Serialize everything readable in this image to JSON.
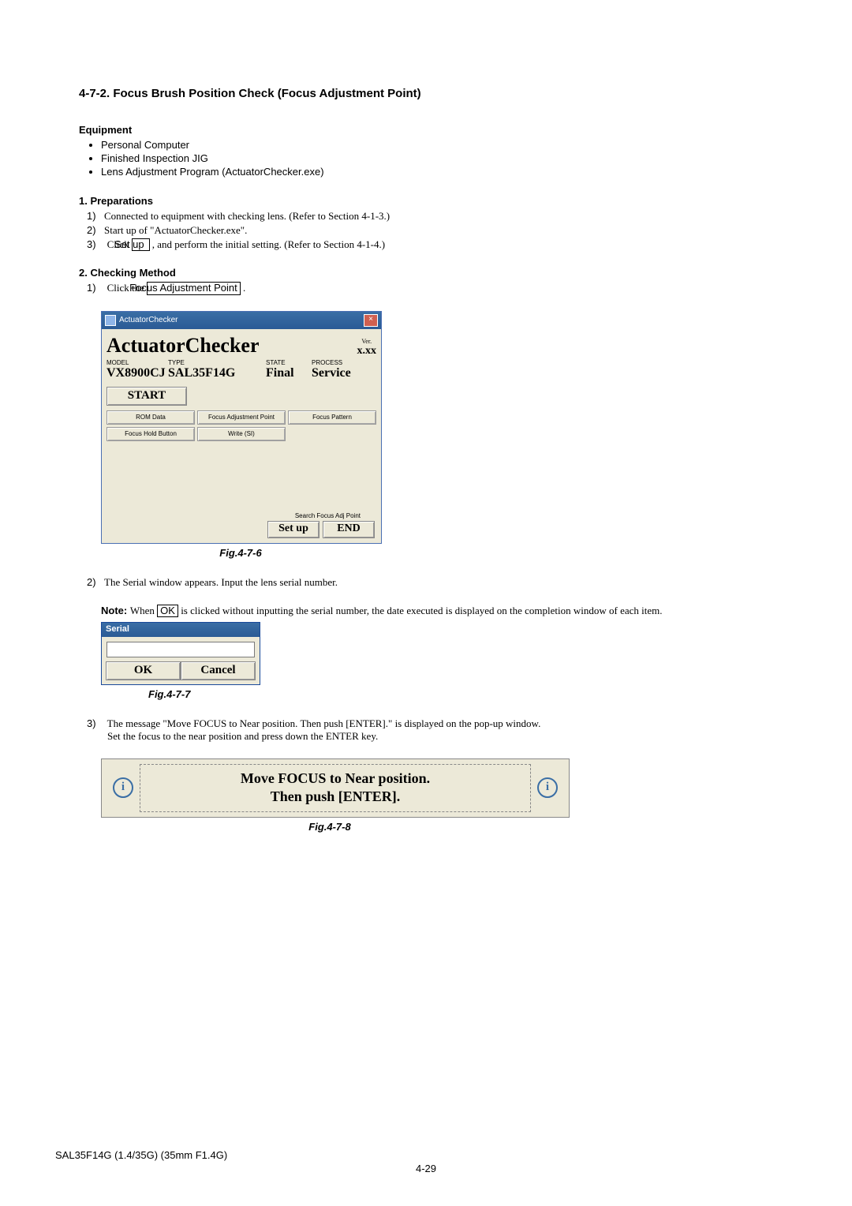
{
  "section": {
    "number": "4-7-2.",
    "title": "Focus Brush Position Check (Focus Adjustment Point)"
  },
  "equipment": {
    "heading": "Equipment",
    "items": [
      "Personal Computer",
      "Finished Inspection JIG",
      "Lens Adjustment Program (ActuatorChecker.exe)"
    ]
  },
  "preparations": {
    "heading": "1.  Preparations",
    "items": {
      "p1": "Connected to equipment with checking lens. (Refer to Section 4-1-3.)",
      "p2": "Start up of \"ActuatorChecker.exe\".",
      "p3_a": "Click ",
      "p3_box": "Set up",
      "p3_b": " , and perform the initial setting. (Refer to Section 4-1-4.)"
    }
  },
  "checking": {
    "heading": "2.  Checking Method",
    "step1_a": "Click the ",
    "step1_box": "Focus Adjustment Point",
    "step1_b": " ."
  },
  "ac_window": {
    "title": "ActuatorChecker",
    "app_title": "ActuatorChecker",
    "ver_label": "Ver.",
    "ver_value": "x.xx",
    "labels": {
      "model": "MODEL",
      "type": "TYPE",
      "state": "STATE",
      "process": "PROCESS"
    },
    "values": {
      "model": "VX8900CJ",
      "type": "SAL35F14G",
      "state": "Final",
      "process": "Service"
    },
    "start": "START",
    "grid": {
      "rom": "ROM Data",
      "fap": "Focus Adjustment Point",
      "fp": "Focus Pattern",
      "fhb": "Focus Hold Button",
      "wsi": "Write (SI)"
    },
    "search": "Search Focus Adj Point",
    "setup": "Set up",
    "end": "END"
  },
  "fig476": "Fig.4-7-6",
  "step2": "The Serial window appears. Input the lens serial number.",
  "note": {
    "label": "Note:",
    "a": "When ",
    "box": "OK",
    "b": " is clicked without inputting the serial number, the date executed is displayed on the completion window of each item."
  },
  "serial": {
    "title": "Serial",
    "ok": "OK",
    "cancel": "Cancel"
  },
  "fig477": "Fig.4-7-7",
  "step3": {
    "line1": "The message \"Move FOCUS to Near position. Then push [ENTER].\" is displayed on the pop-up window.",
    "line2": "Set the focus to the near position and press down the ENTER key."
  },
  "popup": {
    "line1": "Move FOCUS to Near position.",
    "line2": "Then push [ENTER]."
  },
  "fig478": "Fig.4-7-8",
  "footer": {
    "model": "SAL35F14G (1.4/35G) (35mm F1.4G)",
    "page": "4-29"
  }
}
